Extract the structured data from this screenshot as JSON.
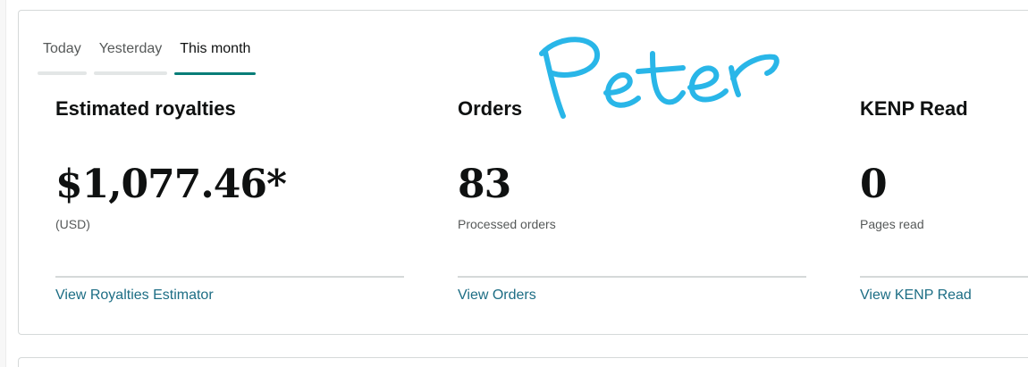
{
  "tabs": [
    {
      "label": "Today",
      "active": false
    },
    {
      "label": "Yesterday",
      "active": false
    },
    {
      "label": "This month",
      "active": true
    }
  ],
  "metrics": [
    {
      "title": "Estimated royalties",
      "value": "$1,077.46*",
      "subtitle": "(USD)",
      "link": "View Royalties Estimator"
    },
    {
      "title": "Orders",
      "value": "83",
      "subtitle": "Processed orders",
      "link": "View Orders"
    },
    {
      "title": "KENP Read",
      "value": "0",
      "subtitle": "Pages read",
      "link": "View KENP Read"
    }
  ],
  "handwriting": {
    "text": "Peter",
    "color": "#29b6e8"
  },
  "colors": {
    "accent": "#067d78",
    "link": "#1c6d84",
    "text": "#0f1111",
    "muted": "#565959"
  }
}
